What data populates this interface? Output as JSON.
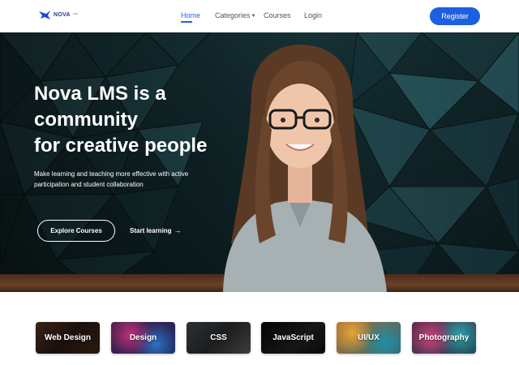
{
  "brand": {
    "name": "NOVA",
    "sup": "LMS"
  },
  "nav": {
    "items": [
      {
        "label": "Home",
        "active": true
      },
      {
        "label": "Categories",
        "has_dropdown": true
      },
      {
        "label": "Courses"
      },
      {
        "label": "Login"
      }
    ],
    "register_label": "Register"
  },
  "hero": {
    "title_lines": [
      "Nova LMS is a",
      "community",
      "for creative people"
    ],
    "subtitle": "Make learning and teaching more effective with active participation and student collaboration",
    "primary_cta": "Explore Courses",
    "secondary_cta": "Start learning",
    "secondary_icon": "arrow-right-icon"
  },
  "categories": [
    {
      "label": "Web Design"
    },
    {
      "label": "Design"
    },
    {
      "label": "CSS"
    },
    {
      "label": "JavaScript"
    },
    {
      "label": "UI/UX"
    },
    {
      "label": "Photography"
    }
  ],
  "colors": {
    "accent": "#1d5fe0",
    "active_link": "#2563eb",
    "hero_bg": "#163338"
  }
}
